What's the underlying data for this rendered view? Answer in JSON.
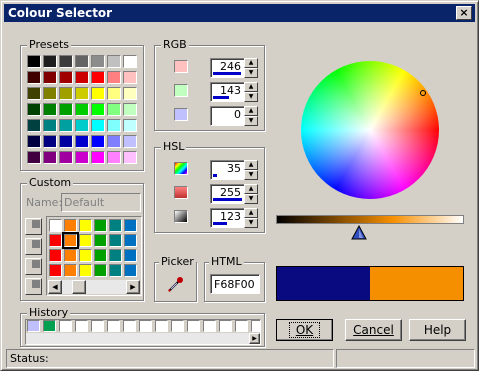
{
  "window": {
    "title": "Colour Selector",
    "close_glyph": "×"
  },
  "presets": {
    "label": "Presets",
    "swatches": [
      "#000000",
      "#1e1e1e",
      "#3c3c3c",
      "#646464",
      "#8c8c8c",
      "#c0c0c0",
      "#ffffff",
      "#400000",
      "#800000",
      "#a00000",
      "#cc0000",
      "#ff0000",
      "#ff8080",
      "#ffc0c0",
      "#404000",
      "#808000",
      "#a0a000",
      "#cccc00",
      "#ffff00",
      "#ffff80",
      "#ffffc0",
      "#004000",
      "#008000",
      "#00a000",
      "#00cc00",
      "#00ff00",
      "#80ff80",
      "#c0ffc0",
      "#004040",
      "#008080",
      "#00a0a0",
      "#00cccc",
      "#00ffff",
      "#80ffff",
      "#c0ffff",
      "#000040",
      "#000080",
      "#0000a0",
      "#0000cc",
      "#0000ff",
      "#8080ff",
      "#c0c0ff",
      "#400040",
      "#800080",
      "#a000a0",
      "#cc00cc",
      "#ff00ff",
      "#ff80ff",
      "#ffc0ff"
    ]
  },
  "custom": {
    "label": "Custom",
    "name_label": "Name:",
    "name_value": "Default",
    "swatches": [
      "#ffffff",
      "#ff8000",
      "#ffff00",
      "#00a000",
      "#008080",
      "#0070c0",
      "#ff0000",
      "#ff8000",
      "#ffff00",
      "#00a000",
      "#008080",
      "#0070c0",
      "#ff0000",
      "#ff8000",
      "#ffff00",
      "#00a000",
      "#008080",
      "#0070c0",
      "#ff0000",
      "#ff8000",
      "#ffff00",
      "#00a000",
      "#008080",
      "#0070c0"
    ],
    "tools": [
      "add-swatch-icon",
      "delete-swatch-icon",
      "edit-swatch-icon",
      "save-swatch-icon"
    ]
  },
  "rgb": {
    "label": "RGB",
    "fields": [
      {
        "name": "red",
        "swatch": "#ffc0c0",
        "value": "246",
        "fill": 0.96
      },
      {
        "name": "green",
        "swatch": "#c0ffc0",
        "value": "143",
        "fill": 0.56
      },
      {
        "name": "blue",
        "swatch": "#c0c0ff",
        "value": "0",
        "fill": 0.0
      }
    ]
  },
  "hsl": {
    "label": "HSL",
    "fields": [
      {
        "name": "hue",
        "swatch": "hue-gradient-icon",
        "value": "35",
        "fill": 0.14
      },
      {
        "name": "saturation",
        "swatch": "saturation-gradient-icon",
        "value": "255",
        "fill": 1.0
      },
      {
        "name": "lightness",
        "swatch": "lightness-gradient-icon",
        "value": "123",
        "fill": 0.48
      }
    ]
  },
  "picker": {
    "label": "Picker",
    "icon": "eyedropper-icon"
  },
  "html": {
    "label": "HTML",
    "value": "F68F00"
  },
  "history": {
    "label": "History",
    "swatches": [
      "#c0c0ff",
      "#00a050",
      "#ffffff",
      "#ffffff",
      "#ffffff",
      "#ffffff",
      "#ffffff",
      "#ffffff",
      "#ffffff",
      "#ffffff",
      "#ffffff",
      "#ffffff",
      "#ffffff",
      "#ffffff",
      "#ffffff",
      "#ffffff"
    ]
  },
  "wheel": {
    "cursor_hue": 35,
    "cursor_saturation": 1.0
  },
  "lightness_slider": {
    "value": 123,
    "max": 255,
    "end_color": "#f68f00"
  },
  "preview": {
    "old_color": "#0a0a80",
    "new_color": "#f68f00"
  },
  "buttons": {
    "ok": "OK",
    "cancel": "Cancel",
    "help": "Help"
  },
  "status": {
    "label": "Status:",
    "text": ""
  },
  "colors": {
    "title_bg": "#0a246a",
    "face": "#d4d0c8"
  }
}
